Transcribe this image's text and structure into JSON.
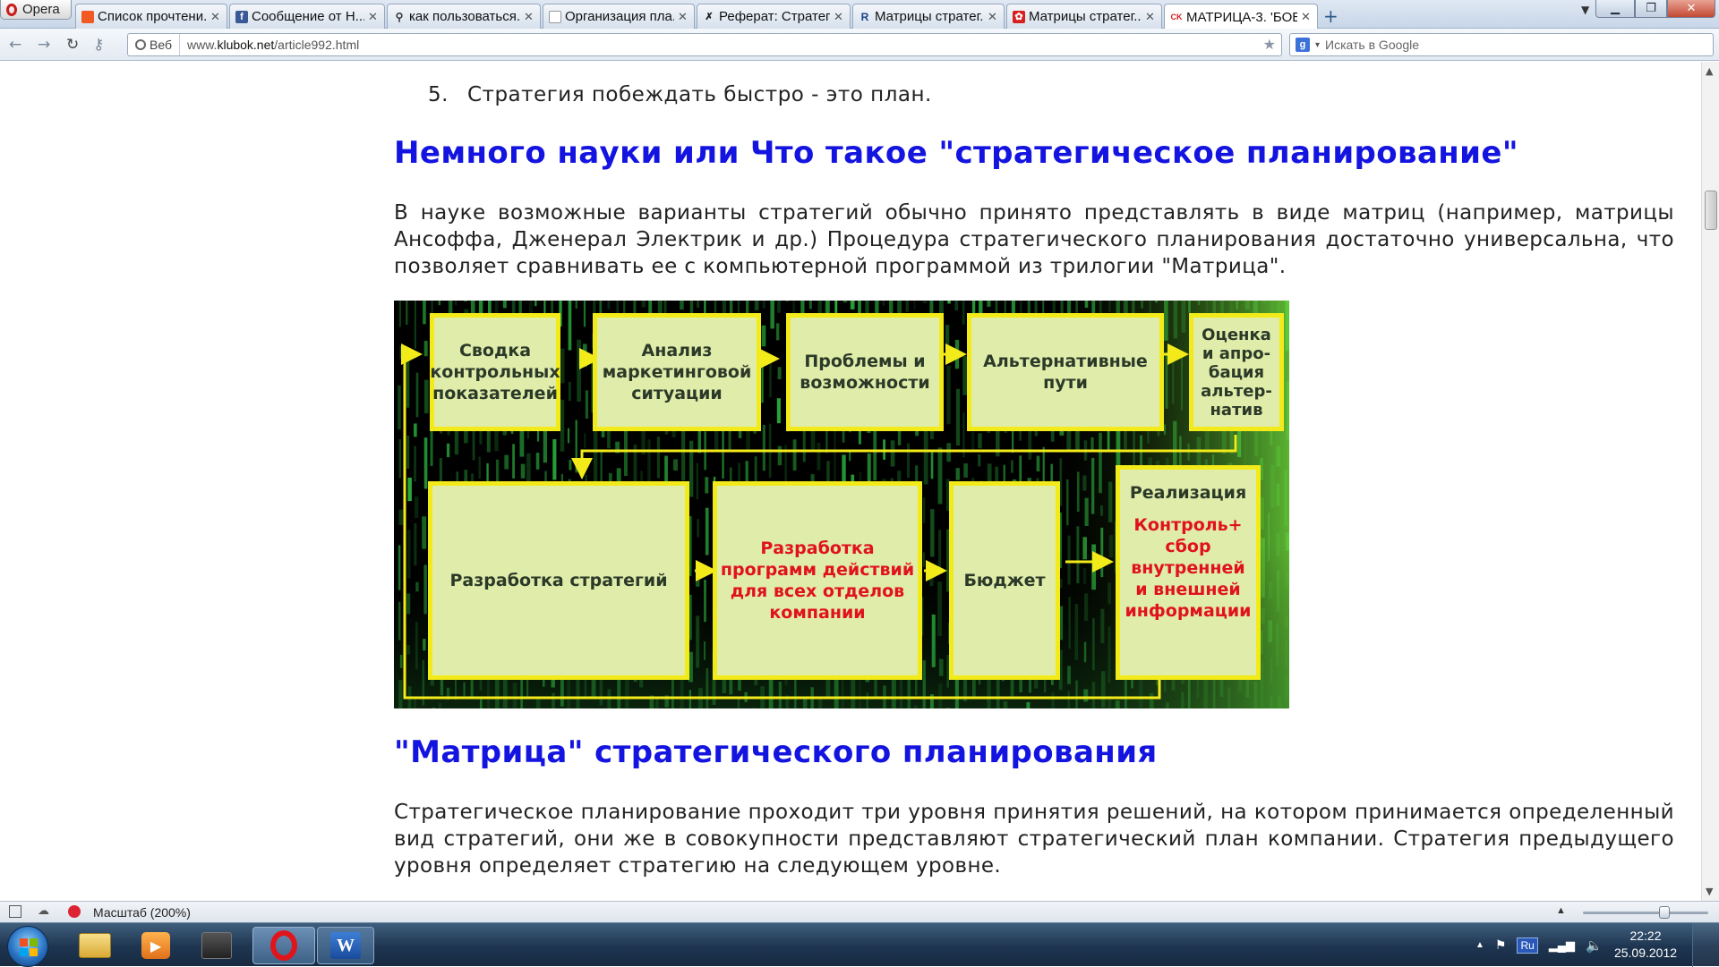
{
  "browser": {
    "menu_label": "Opera",
    "tabs": [
      {
        "label": "Список прочтени...",
        "fav": "#f15a22",
        "favtext": ""
      },
      {
        "label": "Сообщение от Н...",
        "fav": "#3b5998",
        "favtext": "f"
      },
      {
        "label": "как пользоваться...",
        "fav": "#ffffff",
        "favtext": "🔍"
      },
      {
        "label": "Организация пла...",
        "fav": "#ffffff",
        "favtext": ""
      },
      {
        "label": "Реферат: Стратег...",
        "fav": "#ffffff",
        "favtext": "✗"
      },
      {
        "label": "Матрицы стратег...",
        "fav": "#ffffff",
        "favtext": "R"
      },
      {
        "label": "Матрицы стратег...",
        "fav": "#d62020",
        "favtext": "✿"
      },
      {
        "label": "МАТРИЦА-3. 'БОЕ...",
        "fav": "#ffffff",
        "favtext": "CK"
      }
    ],
    "new_tab": "+",
    "web_badge": "Веб",
    "url_prefix": "www.",
    "url_host": "klubok.net",
    "url_path": "/article992.html",
    "search_placeholder": "Искать в Google"
  },
  "article": {
    "list_item_number": "5.",
    "list_item_text": "Стратегия побеждать быстро - это план.",
    "heading1": "Немного науки или Что такое \"стратегическое планирование\"",
    "para1": "В науке возможные варианты стратегий обычно принято представлять в виде матриц (например, матрицы Ансоффа, Дженерал Электрик и др.) Процедура стратегического планирования достаточно универсальна, что позволяет сравнивать ее с компьютерной программой из трилогии \"Матрица\".",
    "diagram": {
      "box1": [
        "Сводка",
        "контрольных",
        "показателей"
      ],
      "box2": [
        "Анализ",
        "маркетинговой",
        "ситуации"
      ],
      "box3": [
        "Проблемы и",
        "возможности"
      ],
      "box4": [
        "Альтернативные",
        "пути"
      ],
      "box5": [
        "Оценка",
        "и апро-",
        "бация",
        "альтер-",
        "натив"
      ],
      "box6": [
        "Разработка стратегий"
      ],
      "box7": [
        "Разработка",
        "программ действий",
        "для всех отделов",
        "компании"
      ],
      "box8": [
        "Бюджет"
      ],
      "box9_title": "Реализация",
      "box9_red": [
        "Контроль+",
        "сбор",
        "внутренней",
        "и внешней",
        "информации"
      ]
    },
    "heading2": "\"Матрица\" стратегического планирования",
    "para2": "Стратегическое планирование проходит три уровня принятия решений, на котором принимается определенный вид стратегий, они же в совокупности представляют стратегический план компании. Стратегия предыдущего уровня определяет стратегию на следующем уровне."
  },
  "status": {
    "zoom_label": "Масштаб (200%)",
    "zoom_percent": 200
  },
  "taskbar": {
    "lang": "Ru",
    "time": "22:22",
    "date": "25.09.2012"
  }
}
